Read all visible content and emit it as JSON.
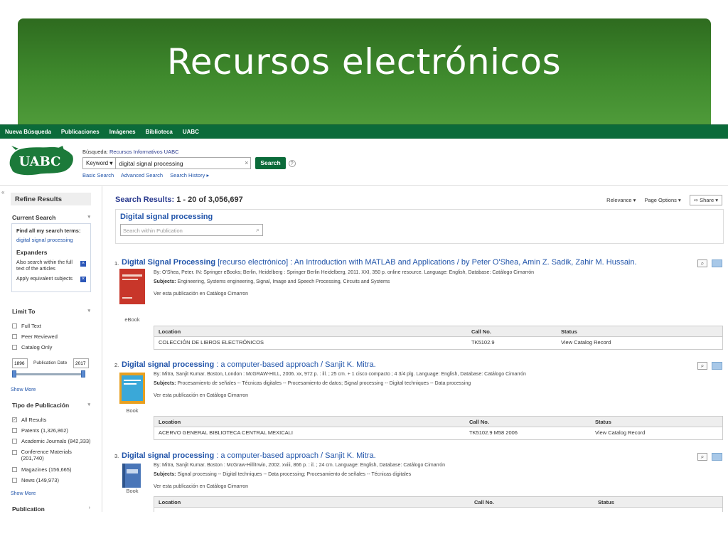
{
  "slide_title": "Recursos electrónicos",
  "topnav": [
    "Nueva Búsqueda",
    "Publicaciones",
    "Imágenes",
    "Biblioteca",
    "UABC"
  ],
  "logo_text": "UABC",
  "search": {
    "label_prefix": "Búsqueda:",
    "label_source": "Recursos Informativos UABC",
    "field_selector": "Keyword",
    "query": "digital signal processing",
    "button": "Search",
    "help": "?",
    "links": [
      "Basic Search",
      "Advanced Search",
      "Search History ▸"
    ]
  },
  "sidebar": {
    "collapse": "«",
    "title": "Refine Results",
    "current_search_heading": "Current Search",
    "find_all_label": "Find all my search terms:",
    "find_all_value": "digital signal processing",
    "expanders_heading": "Expanders",
    "expanders": [
      "Also search within the full text of the articles",
      "Apply equivalent subjects"
    ],
    "limit_to_heading": "Limit To",
    "limit_to": [
      "Full Text",
      "Peer Reviewed",
      "Catalog Only"
    ],
    "date_from": "1896",
    "date_label": "Publication Date",
    "date_to": "2017",
    "show_more": "Show More",
    "type_heading": "Tipo de Publicación",
    "types": [
      "All Results",
      "Patents (1,326,862)",
      "Academic Journals (842,333)",
      "Conference Materials (201,740)",
      "Magazines (156,665)",
      "News (149,973)"
    ],
    "show_more_2": "Show More",
    "publication_heading": "Publication"
  },
  "results_header": {
    "label": "Search Results:",
    "range": "1 - 20 of 3,056,697",
    "relevance": "Relevance ▾",
    "page_options": "Page Options ▾",
    "share": "Share ▾"
  },
  "publication_box": {
    "title": "Digital signal processing",
    "search_placeholder": "Search within Publication"
  },
  "holdings_headers": {
    "location": "Location",
    "call_no": "Call No.",
    "status": "Status"
  },
  "results": [
    {
      "num": "1.",
      "title_bold": "Digital Signal Processing",
      "title_rest": " [recurso electrónico] : An Introduction with MATLAB and Applications / by Peter O'Shea, Amin Z. Sadik, Zahir M. Hussain.",
      "byline": "By: O'Shea, Peter. IN: Springer eBooks; Berlin, Heidelberg : Springer Berlin Heidelberg, 2011. XXI, 350 p. online resource. Language: English, Database: Catálogo Cimarrón",
      "subjects_label": "Subjects:",
      "subjects": "Engineering, Systems engineering, Signal, Image and Speech Processing, Circuits and Systems",
      "catalog_link": "Ver esta publicación en Catálogo Cimarron",
      "type_label": "eBook",
      "location": "COLECCIÓN DE LIBROS ELECTRÓNICOS",
      "call_no": "TK5102.9",
      "status": "View Catalog Record"
    },
    {
      "num": "2.",
      "title_bold": "Digital signal processing",
      "title_rest": " : a computer-based approach / Sanjit K. Mitra.",
      "byline": "By: Mitra, Sanjit Kumar. Boston, London : McGRAW-HILL, 2006. xx, 972 p. : ill. ; 25 cm. + 1 cisco compacto ; 4 3/4 plg. Language: English, Database: Catálogo Cimarrón",
      "subjects_label": "Subjects:",
      "subjects": "Procesamiento de señales -- Técnicas digitales -- Procesamiento de datos; Signal processing -- Digital techniques -- Data processing",
      "catalog_link": "Ver esta publicación en Catálogo Cimarron",
      "type_label": "Book",
      "location": "ACERVO GENERAL BIBLIOTECA CENTRAL MEXICALI",
      "call_no": "TK5102.9 M58 2006",
      "status": "View Catalog Record"
    },
    {
      "num": "3.",
      "title_bold": "Digital signal processing",
      "title_rest": " : a computer-based approach / Sanjit K. Mitra.",
      "byline": "By: Mitra, Sanjit Kumar. Boston : McGraw-Hill/Irwin, 2002. xviii, 866 p. : il. ; 24 cm. Language: English, Database: Catálogo Cimarrón",
      "subjects_label": "Subjects:",
      "subjects": "Signal processing -- Digital techniques -- Data processing; Procesamiento de señales -- Técnicas digitales",
      "catalog_link": "Ver esta publicación en Catálogo Cimarron",
      "type_label": "Book"
    }
  ]
}
